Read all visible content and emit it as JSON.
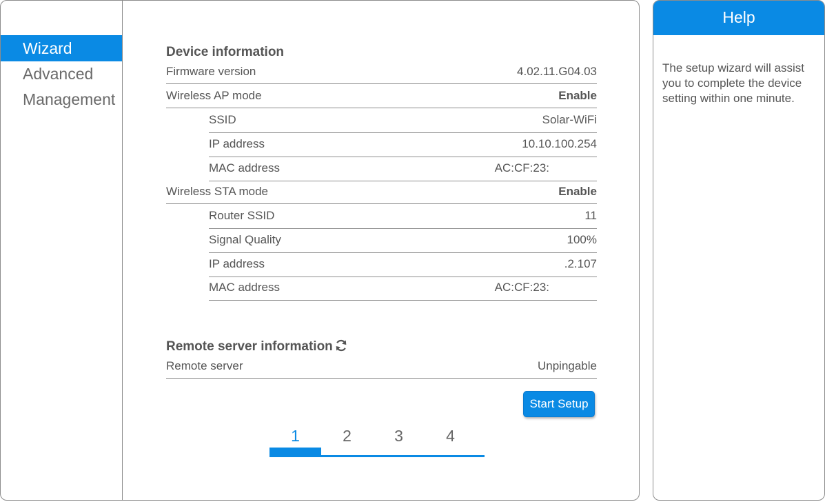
{
  "sidebar": {
    "items": [
      {
        "label": "Wizard",
        "active": true
      },
      {
        "label": "Advanced",
        "active": false
      },
      {
        "label": "Management",
        "active": false
      }
    ]
  },
  "device_info": {
    "title": "Device information",
    "firmware": {
      "label": "Firmware version",
      "value": "4.02.11.G04.03"
    },
    "ap_mode": {
      "label": "Wireless AP mode",
      "value": "Enable"
    },
    "ap": {
      "ssid": {
        "label": "SSID",
        "value": "Solar-WiFi"
      },
      "ip": {
        "label": "IP address",
        "value": "10.10.100.254"
      },
      "mac": {
        "label": "MAC address",
        "value": "AC:CF:23:"
      }
    },
    "sta_mode": {
      "label": "Wireless STA mode",
      "value": "Enable"
    },
    "sta": {
      "router_ssid": {
        "label": "Router SSID",
        "value": "11"
      },
      "signal": {
        "label": "Signal Quality",
        "value": "100%"
      },
      "ip": {
        "label": "IP address",
        "value": ".2.107"
      },
      "mac": {
        "label": "MAC address",
        "value": "AC:CF:23:"
      }
    }
  },
  "remote": {
    "title": "Remote server information",
    "server": {
      "label": "Remote server",
      "value": "Unpingable"
    }
  },
  "start_button": "Start Setup",
  "steps": [
    "1",
    "2",
    "3",
    "4"
  ],
  "active_step": 1,
  "help": {
    "title": "Help",
    "text": "The setup wizard will assist you to complete the device setting within one minute."
  },
  "colors": {
    "accent": "#0a8ae4",
    "border": "#8c8c8c",
    "text": "#555555"
  },
  "icons": {
    "refresh": "refresh-icon"
  }
}
